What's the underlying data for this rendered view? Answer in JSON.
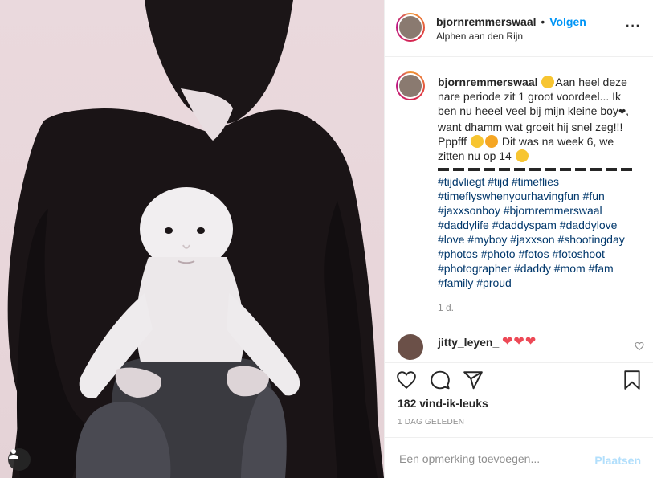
{
  "post": {
    "username": "bjornremmerswaal",
    "separator": "•",
    "follow_label": "Volgen",
    "location": "Alphen aan den Rijn",
    "more_icon": "more-horizontal-icon"
  },
  "caption": {
    "username": "bjornremmerswaal",
    "line1": "Aan heel deze nare periode zit 1 groot voordeel... Ik ben nu heeel veel bij mijn kleine boy",
    "heart": "❤",
    "line2": ", want dhamm wat groeit hij snel zeg!!! Pppfff",
    "line3": "Dit was na week 6, we zitten nu op 14",
    "hashtags": [
      "#tijdvliegt",
      "#tijd",
      "#timeflies",
      "#timeflyswhenyourhavingfun",
      "#fun",
      "#jaxxsonboy",
      "#bjornremmerswaal",
      "#daddylife",
      "#daddyspam",
      "#daddylove",
      "#love",
      "#myboy",
      "#jaxxson",
      "#shootingday",
      "#photos",
      "#photo",
      "#fotos",
      "#fotoshoot",
      "#photographer",
      "#daddy",
      "#mom",
      "#fam",
      "#family",
      "#proud"
    ],
    "time_ago": "1 d."
  },
  "comment": {
    "username": "jitty_leyen_",
    "text": "❤❤❤"
  },
  "actions": {
    "like_icon": "heart-icon",
    "comment_icon": "comment-icon",
    "share_icon": "share-icon",
    "save_icon": "bookmark-icon"
  },
  "likes_text": "182 vind-ik-leuks",
  "date_text": "1 DAG GELEDEN",
  "add_comment": {
    "placeholder": "Een opmerking toevoegen...",
    "post_label": "Plaatsen"
  },
  "colors": {
    "link": "#0095f6",
    "hashtag": "#00376b",
    "heart": "#ed4956",
    "muted": "#8e8e8e"
  }
}
